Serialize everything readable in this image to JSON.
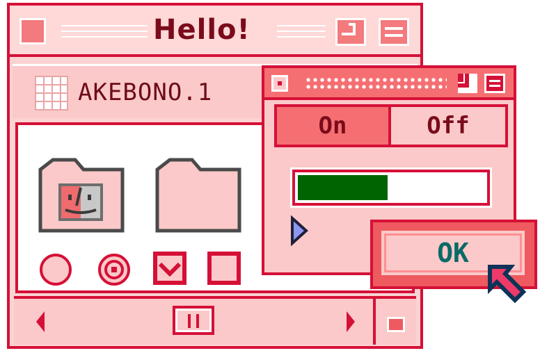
{
  "main_window": {
    "title": "Hello!",
    "address": "AKEBONO.1"
  },
  "popup": {
    "tabs": [
      {
        "label": "On",
        "selected": true
      },
      {
        "label": "Off",
        "selected": false
      }
    ],
    "progress": 0.48,
    "ok_label": "OK"
  },
  "controls": {
    "radio_1": "unchecked",
    "radio_2": "checked",
    "checkbox_1": "checked",
    "checkbox_2": "unchecked"
  },
  "colors": {
    "accent": "#d51037",
    "window_bg": "#fbd3d3",
    "progress_fill": "#006400",
    "ok_text": "#0b6a66"
  },
  "icons": [
    "grid-icon",
    "finder-folder-icon",
    "folder-icon",
    "radio-icon",
    "checkbox-icon",
    "arrow-left-icon",
    "arrow-right-icon",
    "scroll-thumb-icon",
    "pointer-cursor-icon",
    "blue-arrow-cursor-icon",
    "close-box-icon",
    "zoom-box-icon",
    "collapse-box-icon"
  ]
}
